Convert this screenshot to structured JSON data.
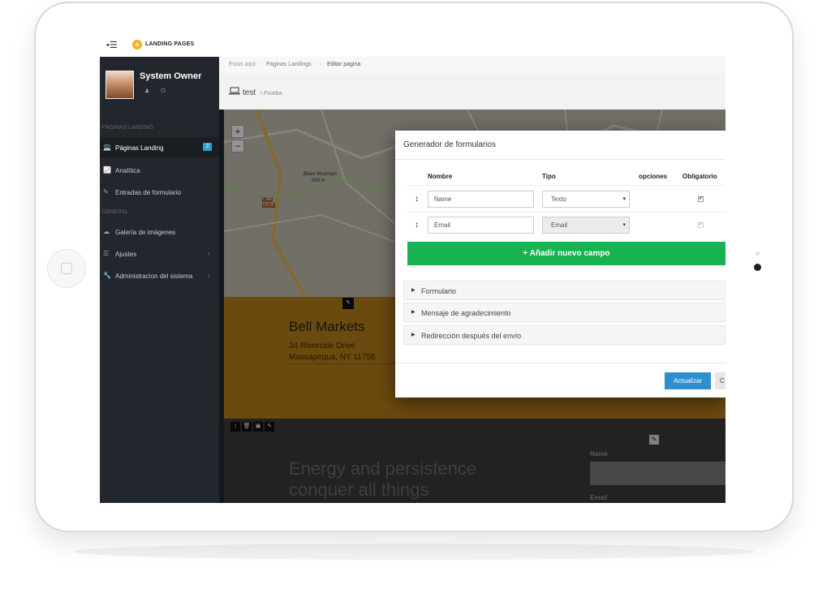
{
  "app": {
    "menu_toggle": "•☰",
    "brand_icon": "a",
    "brand_label": "LANDING PAGES"
  },
  "sidebar": {
    "user_name": "System Owner",
    "user_icons": "♟ ⏻",
    "sections": [
      {
        "label": "PÁGINAS LANDING"
      },
      {
        "label": "GENERAL"
      }
    ],
    "items": [
      {
        "icon": "💻",
        "label": "Páginas Landing",
        "badge": "2",
        "active": true
      },
      {
        "icon": "📈",
        "label": "Analítica"
      },
      {
        "icon": "✎",
        "label": "Entradas de formulario"
      },
      {
        "icon": "☁",
        "label": "Galería de imágenes"
      },
      {
        "icon": "☰",
        "label": "Ajustes",
        "chevron": "›"
      },
      {
        "icon": "🔧",
        "label": "Administracion del sistema",
        "chevron": "›"
      }
    ]
  },
  "breadcrumb": {
    "prefix": "Estas aqui:",
    "crumbs": [
      "Paginas Landings",
      "Editar pagina"
    ],
    "separator": "›"
  },
  "page": {
    "title": "test",
    "subtitle": "\\ Prueba"
  },
  "map": {
    "zoom_in": "+",
    "zoom_out": "−",
    "labels": {
      "black_mountain": "Black Mountain",
      "elevation": "559 m",
      "i280": "I 280",
      "ca35": "CA 35"
    }
  },
  "canvas": {
    "map_handle": "✎",
    "card_title": "Bell Markets",
    "card_line1": "34 Riverside Drive",
    "card_line2": "Massapequa, NY 11758",
    "tool_icons": [
      "↕",
      "🗑",
      "▣",
      "✎"
    ],
    "hero_line1": "Energy and persistence",
    "hero_line2": "conquer all things",
    "form_edit": "✎",
    "form_name_label": "Name",
    "form_email_label": "Email"
  },
  "modal": {
    "title": "Generador de formularios",
    "columns": {
      "nombre": "Nombre",
      "tipo": "Tipo",
      "opciones": "opciones",
      "obligatorio": "Obligatorio"
    },
    "rows": [
      {
        "drag": "↕",
        "name": "Name",
        "type": "Texto",
        "required_mark": "✔"
      },
      {
        "drag": "↕",
        "name": "Email",
        "type": "Email",
        "required_mark": "✔"
      }
    ],
    "select_caret": "▾",
    "add_button": "+ Añadir nuevo campo",
    "accordion": [
      {
        "arrow": "▶",
        "label": "Formulario"
      },
      {
        "arrow": "▶",
        "label": "Mensaje de agradecimiento"
      },
      {
        "arrow": "▶",
        "label": "Redirección después del envío"
      }
    ],
    "update_button": "Actualizar",
    "close_button": "C"
  },
  "colors": {
    "sidebar_bg": "#22272d",
    "accent_blue": "#2ba1d8",
    "add_green": "#17b350",
    "update_blue": "#2d8fd0",
    "canvas_gold": "#b8801a"
  }
}
